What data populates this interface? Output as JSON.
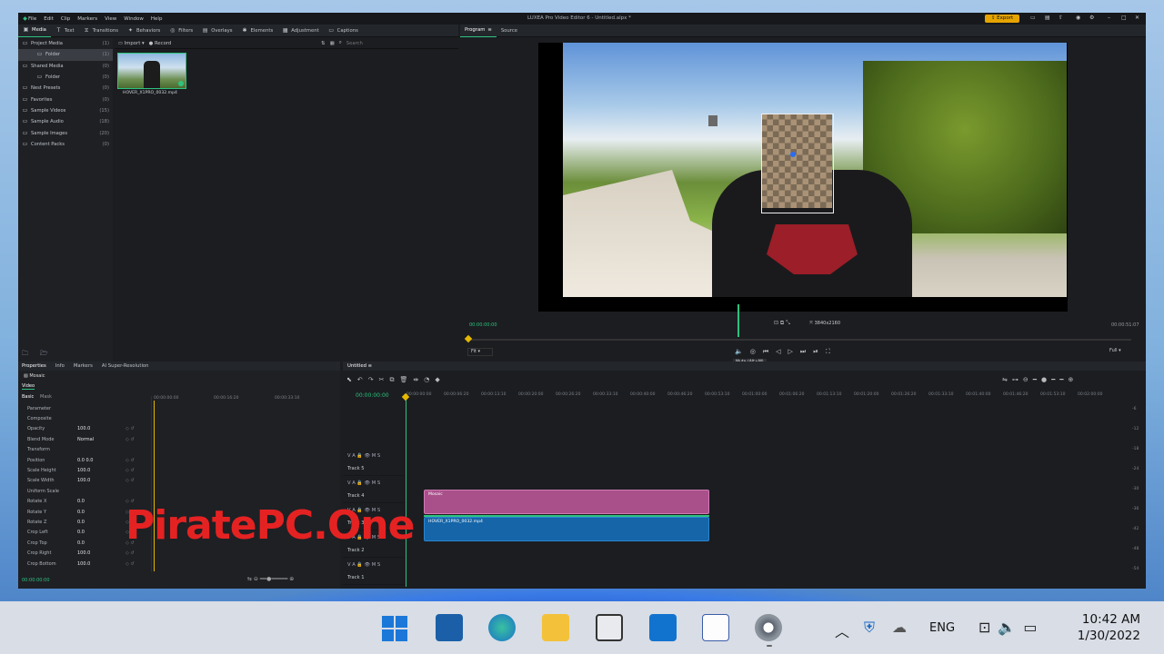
{
  "app": {
    "title": "LUXEA Pro Video Editor 6 - Untitled.alpx *",
    "menu": [
      "File",
      "Edit",
      "Clip",
      "Markers",
      "View",
      "Window",
      "Help"
    ],
    "export_label": "Export"
  },
  "media_tabs": [
    "Media",
    "Text",
    "Transitions",
    "Behaviors",
    "Filters",
    "Overlays",
    "Elements",
    "Adjustment",
    "Captions"
  ],
  "sidebar": {
    "items": [
      {
        "label": "Project Media",
        "count": "(1)"
      },
      {
        "label": "Folder",
        "count": "(1)"
      },
      {
        "label": "Shared Media",
        "count": "(0)"
      },
      {
        "label": "Folder",
        "count": "(0)"
      },
      {
        "label": "Nest Presets",
        "count": "(0)"
      },
      {
        "label": "Favorites",
        "count": "(0)"
      },
      {
        "label": "Sample Videos",
        "count": "(15)"
      },
      {
        "label": "Sample Audio",
        "count": "(18)"
      },
      {
        "label": "Sample Images",
        "count": "(20)"
      },
      {
        "label": "Content Packs",
        "count": "(0)"
      }
    ]
  },
  "media_toolbar": {
    "import": "Import",
    "record": "Record",
    "search_placeholder": "Search"
  },
  "media_item": {
    "name": "HOVER_X1PRO_0032.mp4"
  },
  "preview": {
    "tabs": [
      "Program",
      "Source"
    ],
    "timecode_left": "00:00:00:00",
    "timecode_right": "00:00:51:07",
    "resolution": "3840x2160",
    "fit": "Fit",
    "full": "Full",
    "tooltip": "Mute (Alt+M)"
  },
  "properties": {
    "tabs": [
      "Properties",
      "Info",
      "Markers",
      "AI Super-Resolution"
    ],
    "clip_name": "Mosaic",
    "section": "Video",
    "subtabs": [
      "Basic",
      "Mask"
    ],
    "rows": [
      {
        "label": "Parameter",
        "value": ""
      },
      {
        "label": "Composite",
        "value": ""
      },
      {
        "label": "Opacity",
        "value": "100.0"
      },
      {
        "label": "Blend Mode",
        "value": "Normal"
      },
      {
        "label": "Transform",
        "value": ""
      },
      {
        "label": "Position",
        "value": "0.0     0.0"
      },
      {
        "label": "Scale Height",
        "value": "100.0"
      },
      {
        "label": "Scale Width",
        "value": "100.0"
      },
      {
        "label": "Uniform Scale",
        "value": ""
      },
      {
        "label": "Rotate X",
        "value": "0.0"
      },
      {
        "label": "Rotate Y",
        "value": "0.0"
      },
      {
        "label": "Rotate Z",
        "value": "0.0"
      },
      {
        "label": "Crop Left",
        "value": "0.0"
      },
      {
        "label": "Crop Top",
        "value": "0.0"
      },
      {
        "label": "Crop Right",
        "value": "100.0"
      },
      {
        "label": "Crop Bottom",
        "value": "100.0"
      }
    ],
    "ruler": [
      "00:00:00:00",
      "00:00:16:20",
      "00:00:33:10"
    ],
    "footer_time": "00:00:00:00"
  },
  "timeline": {
    "tab": "Untitled",
    "timecode": "00:00:00:00",
    "ruler": [
      "00:00:00:00",
      "00:00:06:20",
      "00:00:13:10",
      "00:00:20:00",
      "00:00:26:20",
      "00:00:33:10",
      "00:00:40:00",
      "00:00:46:20",
      "00:00:53:10",
      "00:01:00:00",
      "00:01:06:20",
      "00:01:13:10",
      "00:01:20:00",
      "00:01:26:20",
      "00:01:33:10",
      "00:01:40:00",
      "00:01:46:20",
      "00:01:53:10",
      "00:02:00:00"
    ],
    "tracks": [
      "Track 5",
      "Track 4",
      "Track 3",
      "Track 2",
      "Track 1"
    ],
    "track_buttons": "V  A  🔒  👁  M  S",
    "clips": {
      "mosaic": "Mosaic",
      "video": "HOVER_X1PRO_0032.mp4"
    },
    "meter": [
      "-6",
      "-12",
      "-18",
      "-24",
      "-30",
      "-36",
      "-42",
      "-48",
      "-54"
    ]
  },
  "watermark": "PiratePC.One",
  "taskbar": {
    "lang": "ENG",
    "time": "10:42 AM",
    "date": "1/30/2022"
  }
}
